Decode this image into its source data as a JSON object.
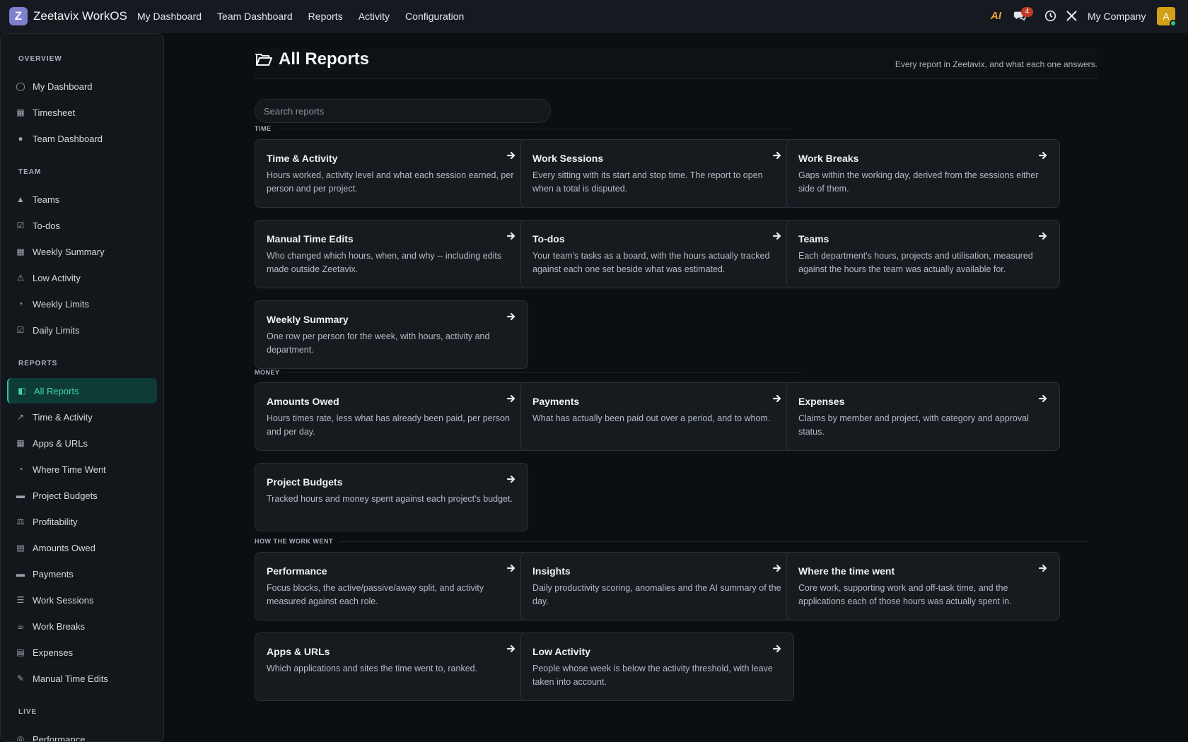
{
  "app": {
    "logo_letter": "Z",
    "name": "Zeetavix WorkOS",
    "nav": [
      "My Dashboard",
      "Team Dashboard",
      "Reports",
      "Activity",
      "Configuration"
    ],
    "ai_label": "AI",
    "chat_count": "4",
    "company": "My Company",
    "avatar_letter": "A"
  },
  "sidebar": {
    "sections": [
      {
        "title": "OVERVIEW",
        "items": [
          {
            "label": "My Dashboard",
            "icon": "user-icon"
          },
          {
            "label": "Timesheet",
            "icon": "calendar-icon"
          },
          {
            "label": "Team Dashboard",
            "icon": "users-icon"
          }
        ]
      },
      {
        "title": "TEAM",
        "items": [
          {
            "label": "Teams",
            "icon": "sitemap-icon"
          },
          {
            "label": "To-dos",
            "icon": "checkbox-icon"
          },
          {
            "label": "Weekly Summary",
            "icon": "table-icon"
          },
          {
            "label": "Low Activity",
            "icon": "warning-icon"
          },
          {
            "label": "Weekly Limits",
            "icon": "gauge-icon"
          },
          {
            "label": "Daily Limits",
            "icon": "calendar-check-icon"
          }
        ]
      },
      {
        "title": "REPORTS",
        "items": [
          {
            "label": "All Reports",
            "icon": "folder-open-icon",
            "active": true
          },
          {
            "label": "Time & Activity",
            "icon": "line-chart-icon"
          },
          {
            "label": "Apps & URLs",
            "icon": "grid-icon"
          },
          {
            "label": "Where Time Went",
            "icon": "pie-chart-icon"
          },
          {
            "label": "Project Budgets",
            "icon": "briefcase-icon"
          },
          {
            "label": "Profitability",
            "icon": "scale-icon"
          },
          {
            "label": "Amounts Owed",
            "icon": "money-icon"
          },
          {
            "label": "Payments",
            "icon": "credit-card-icon"
          },
          {
            "label": "Work Sessions",
            "icon": "list-icon"
          },
          {
            "label": "Work Breaks",
            "icon": "coffee-icon"
          },
          {
            "label": "Expenses",
            "icon": "receipt-icon"
          },
          {
            "label": "Manual Time Edits",
            "icon": "edit-icon"
          }
        ]
      },
      {
        "title": "LIVE",
        "items": [
          {
            "label": "Performance",
            "icon": "target-icon"
          }
        ]
      }
    ]
  },
  "page": {
    "title": "All Reports",
    "subtitle": "Every report in Zeetavix, and what each one answers.",
    "search_placeholder": "Search reports"
  },
  "groups": [
    {
      "label": "TIME",
      "cards": [
        {
          "title": "Time & Activity",
          "desc": "Hours worked, activity level and what each session earned, per person and per project."
        },
        {
          "title": "Work Sessions",
          "desc": "Every sitting with its start and stop time. The report to open when a total is disputed."
        },
        {
          "title": "Work Breaks",
          "desc": "Gaps within the working day, derived from the sessions either side of them."
        },
        {
          "title": "Manual Time Edits",
          "desc": "Who changed which hours, when, and why -- including edits made outside Zeetavix."
        },
        {
          "title": "To-dos",
          "desc": "Your team's tasks as a board, with the hours actually tracked against each one set beside what was estimated."
        },
        {
          "title": "Teams",
          "desc": "Each department's hours, projects and utilisation, measured against the hours the team was actually available for."
        },
        {
          "title": "Weekly Summary",
          "desc": "One row per person for the week, with hours, activity and department."
        }
      ]
    },
    {
      "label": "MONEY",
      "cards": [
        {
          "title": "Amounts Owed",
          "desc": "Hours times rate, less what has already been paid, per person and per day."
        },
        {
          "title": "Payments",
          "desc": "What has actually been paid out over a period, and to whom."
        },
        {
          "title": "Expenses",
          "desc": "Claims by member and project, with category and approval status."
        },
        {
          "title": "Project Budgets",
          "desc": "Tracked hours and money spent against each project's budget."
        }
      ]
    },
    {
      "label": "HOW THE WORK WENT",
      "cards": [
        {
          "title": "Performance",
          "desc": "Focus blocks, the active/passive/away split, and activity measured against each role."
        },
        {
          "title": "Insights",
          "desc": "Daily productivity scoring, anomalies and the AI summary of the day."
        },
        {
          "title": "Where the time went",
          "desc": "Core work, supporting work and off-task time, and the applications each of those hours was actually spent in."
        },
        {
          "title": "Apps & URLs",
          "desc": "Which applications and sites the time went to, ranked."
        },
        {
          "title": "Low Activity",
          "desc": "People whose week is below the activity threshold, with leave taken into account."
        }
      ]
    }
  ]
}
